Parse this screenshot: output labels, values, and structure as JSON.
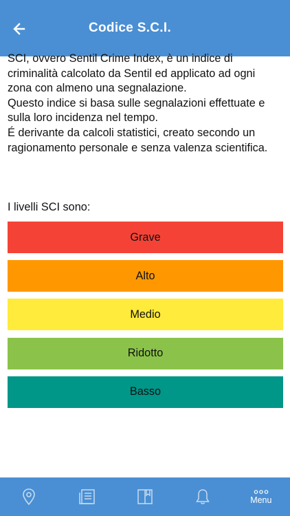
{
  "header": {
    "title": "Codice S.C.I.",
    "back_icon": "arrow-left-icon",
    "background": "#4a8fd3"
  },
  "main": {
    "description": "SCI, ovvero Sentil Crime Index, è un indice di\ncriminalità calcolato da Sentil ed applicato ad ogni\nzona con almeno una segnalazione.\nQuesto indice si basa sulle segnalazioni effettuate e\nsulla loro incidenza nel tempo.\nÉ derivante da calcoli statistici, creato secondo un\nragionamento personale e senza valenza scientifica.",
    "levels_heading": "I livelli SCI sono:",
    "levels": [
      {
        "label": "Grave",
        "color": "#f44336"
      },
      {
        "label": "Alto",
        "color": "#ff9800"
      },
      {
        "label": "Medio",
        "color": "#ffeb3b"
      },
      {
        "label": "Ridotto",
        "color": "#8bc34a"
      },
      {
        "label": "Basso",
        "color": "#009688"
      }
    ]
  },
  "tabbar": {
    "tabs": [
      {
        "icon": "map-pin-icon"
      },
      {
        "icon": "list-document-icon"
      },
      {
        "icon": "bookmark-book-icon"
      },
      {
        "icon": "bell-icon"
      },
      {
        "icon": "more-dots-icon",
        "label": "Menu"
      }
    ]
  }
}
